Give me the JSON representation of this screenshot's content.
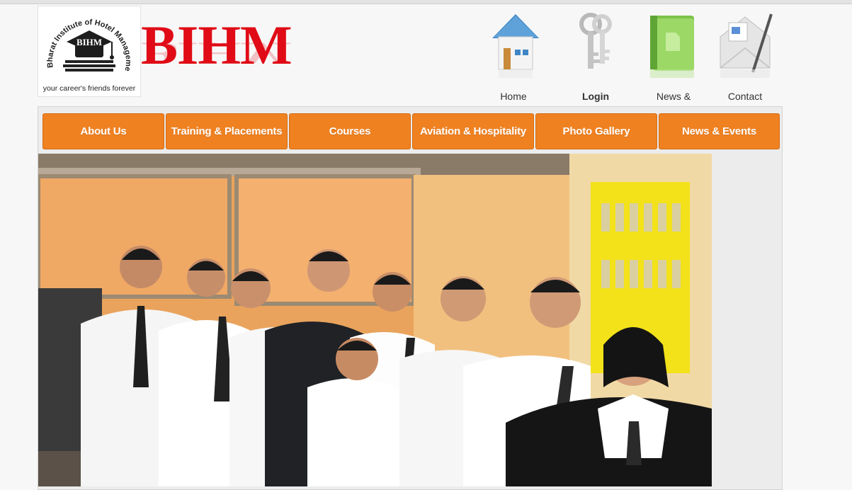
{
  "logo": {
    "ring_text": "Bharat Institute of Hotel Management",
    "badge_text": "BIHM",
    "tagline": "your career's friends forever",
    "brand": "BIHM"
  },
  "top_nav": [
    {
      "label": "Home Us",
      "icon": "house-icon"
    },
    {
      "label": "Login",
      "icon": "keys-icon"
    },
    {
      "label": "News & Events",
      "icon": "green-folder-icon"
    },
    {
      "label": "Contact",
      "icon": "mail-envelope-icon"
    }
  ],
  "main_menu": [
    {
      "label": "About Us"
    },
    {
      "label": "Training & Placements"
    },
    {
      "label": "Courses"
    },
    {
      "label": "Aviation & Hospitality"
    },
    {
      "label": "Photo Gallery"
    },
    {
      "label": "News & Events"
    }
  ],
  "colors": {
    "menu_orange": "#ef8121",
    "brand_red": "#e00b16"
  },
  "slideshow": {
    "image": "group-photo-of-students-in-uniform"
  }
}
